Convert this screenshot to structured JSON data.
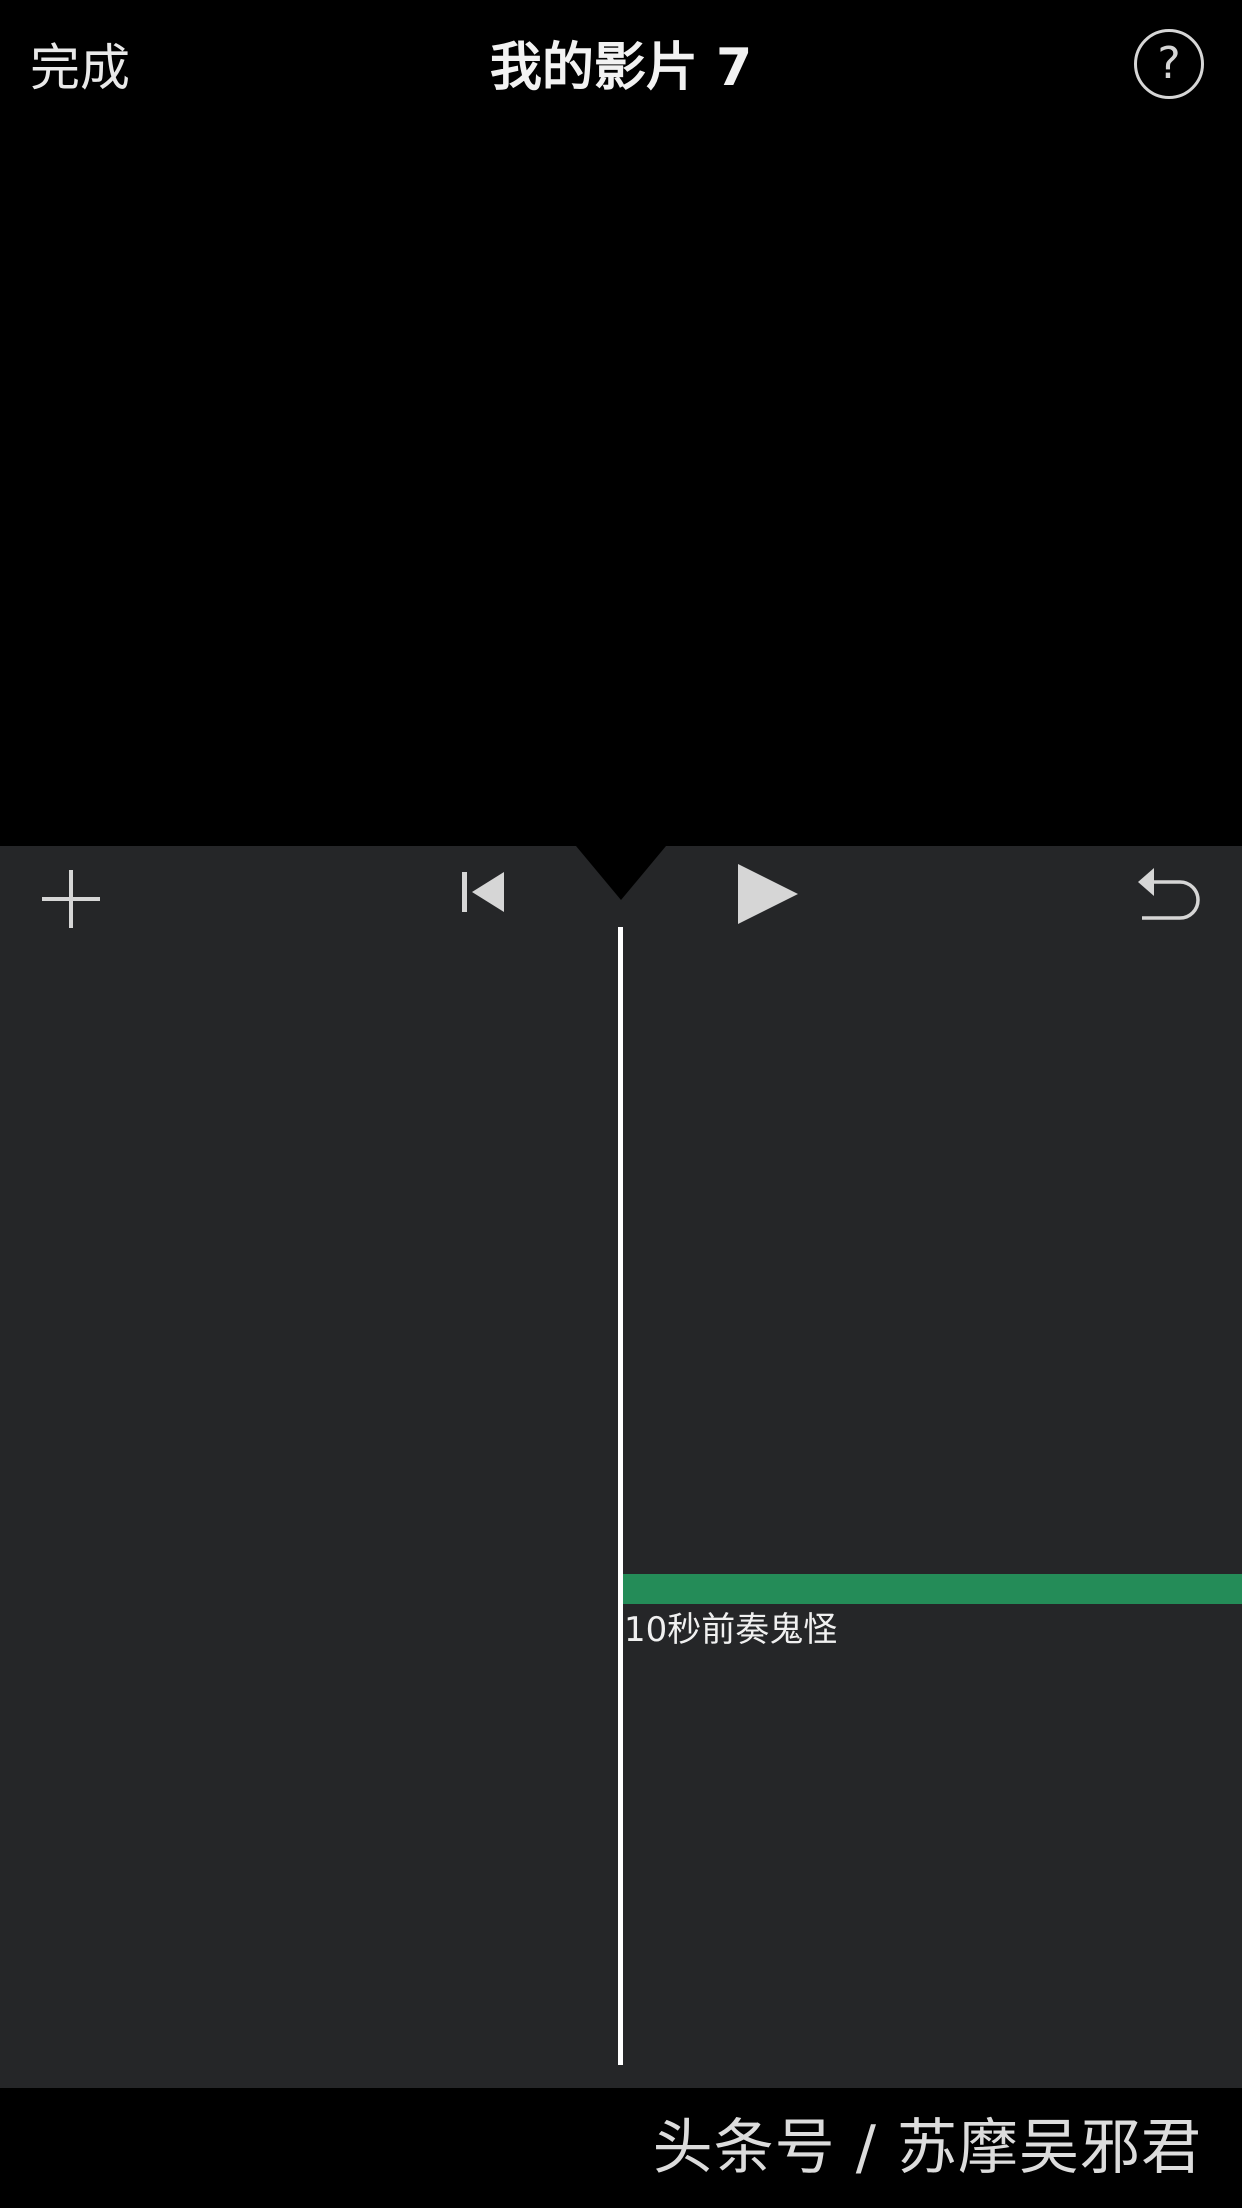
{
  "header": {
    "done_label": "完成",
    "title": "我的影片 7",
    "help_label": "?"
  },
  "toolbar": {
    "add_icon": "plus-icon",
    "skip_back_icon": "skip-to-start-icon",
    "play_icon": "play-icon",
    "undo_icon": "undo-icon"
  },
  "timeline": {
    "audio_clip": {
      "label": "10秒前奏鬼怪",
      "color": "#248c58"
    }
  },
  "watermark": {
    "text": "头条号 / 苏摩吴邪君"
  },
  "colors": {
    "viewer_bg": "#000000",
    "editor_bg": "#252628",
    "playhead": "#ffffff",
    "icon": "#d6d6d6"
  }
}
